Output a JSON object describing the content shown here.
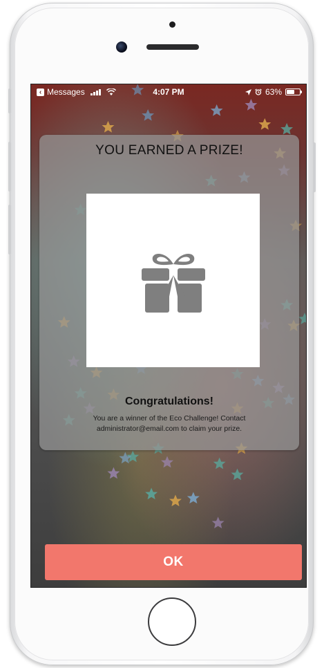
{
  "status_bar": {
    "back_label": "Messages",
    "time": "4:07 PM",
    "battery_percent": "63%",
    "battery_level": 0.63
  },
  "modal": {
    "title": "YOU EARNED A PRIZE!",
    "image_icon": "gift-icon",
    "heading": "Congratulations!",
    "message": "You are a winner of the Eco Challenge! Contact administrator@email.com to claim your prize."
  },
  "ok_button": {
    "label": "OK"
  },
  "colors": {
    "accent": "#f2776c",
    "gift_icon": "#7f7f7f",
    "modal_overlay": "#969696"
  }
}
